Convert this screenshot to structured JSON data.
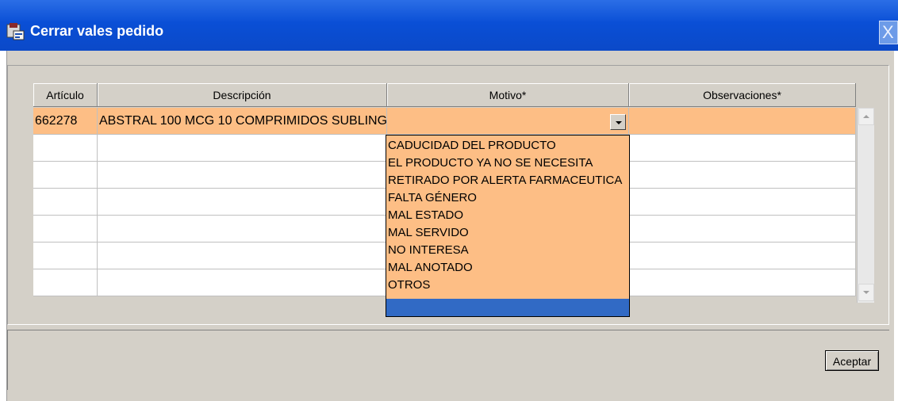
{
  "window": {
    "title": "Cerrar vales pedido",
    "close_glyph": "X",
    "icon": "app-icon",
    "titlebar_color": "#0b4fd6"
  },
  "table": {
    "columns": [
      {
        "label": "Artículo"
      },
      {
        "label": "Descripción"
      },
      {
        "label": "Motivo*"
      },
      {
        "label": "Observaciones*"
      }
    ],
    "rows": [
      {
        "articulo": "662278",
        "descripcion": "ABSTRAL 100 MCG 10 COMPRIMIDOS SUBLING",
        "motivo": "",
        "observaciones": ""
      },
      {
        "articulo": "",
        "descripcion": "",
        "motivo": "",
        "observaciones": ""
      },
      {
        "articulo": "",
        "descripcion": "",
        "motivo": "",
        "observaciones": ""
      },
      {
        "articulo": "",
        "descripcion": "",
        "motivo": "",
        "observaciones": ""
      },
      {
        "articulo": "",
        "descripcion": "",
        "motivo": "",
        "observaciones": ""
      },
      {
        "articulo": "",
        "descripcion": "",
        "motivo": "",
        "observaciones": ""
      },
      {
        "articulo": "",
        "descripcion": "",
        "motivo": "",
        "observaciones": ""
      }
    ],
    "selected_row_color": "#fdbe85"
  },
  "motivo_dropdown": {
    "options": [
      "CADUCIDAD DEL PRODUCTO",
      "EL PRODUCTO YA NO SE NECESITA",
      "RETIRADO POR ALERTA FARMACEUTICA",
      "FALTA GÉNERO",
      "MAL ESTADO",
      "MAL SERVIDO",
      "NO INTERESA",
      "MAL ANOTADO",
      "OTROS",
      ""
    ],
    "highlight_color": "#316ac5"
  },
  "footer": {
    "accept_label": "Aceptar"
  }
}
